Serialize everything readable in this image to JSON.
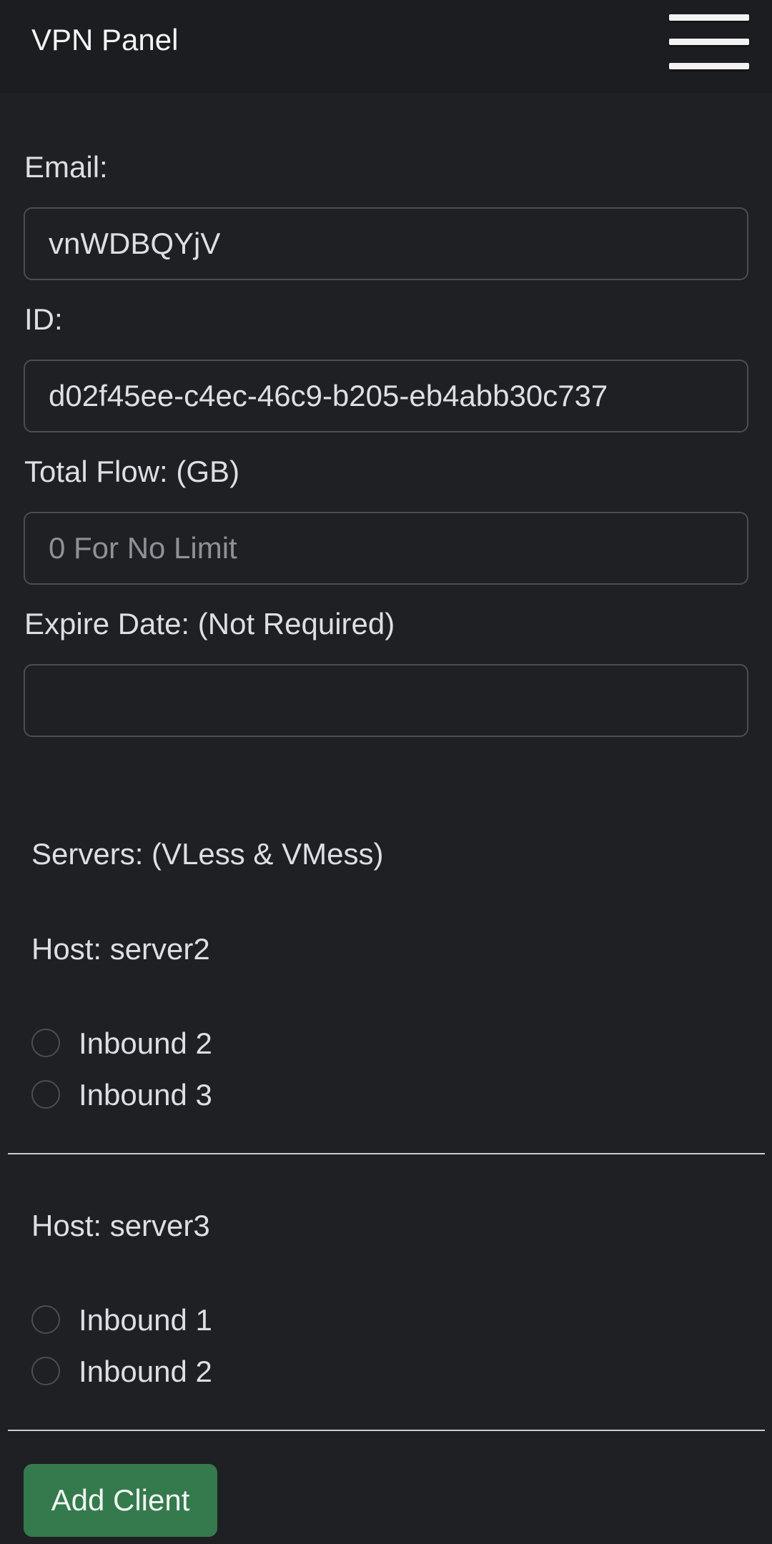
{
  "header": {
    "brand": "VPN Panel",
    "menu_icon": "hamburger-menu-icon"
  },
  "form": {
    "email": {
      "label": "Email:",
      "value": "vnWDBQYjV"
    },
    "id": {
      "label": "ID:",
      "value": "d02f45ee-c4ec-46c9-b205-eb4abb30c737"
    },
    "total_flow": {
      "label": "Total Flow: (GB)",
      "value": "",
      "placeholder": "0 For No Limit"
    },
    "expire_date": {
      "label": "Expire Date: (Not Required)",
      "value": ""
    }
  },
  "servers": {
    "title": "Servers: (VLess & VMess)",
    "hosts": [
      {
        "label": "Host: server2",
        "inbounds": [
          {
            "label": "Inbound 2",
            "checked": false
          },
          {
            "label": "Inbound 3",
            "checked": false
          }
        ]
      },
      {
        "label": "Host: server3",
        "inbounds": [
          {
            "label": "Inbound 1",
            "checked": false
          },
          {
            "label": "Inbound 2",
            "checked": false
          }
        ]
      }
    ]
  },
  "actions": {
    "add_client_label": "Add Client",
    "add_client_color": "#347a4d"
  },
  "theme": {
    "background": "#1e2023",
    "navbar": "#1b1d20",
    "border": "#4a4e53",
    "text": "#dcdfe3"
  }
}
